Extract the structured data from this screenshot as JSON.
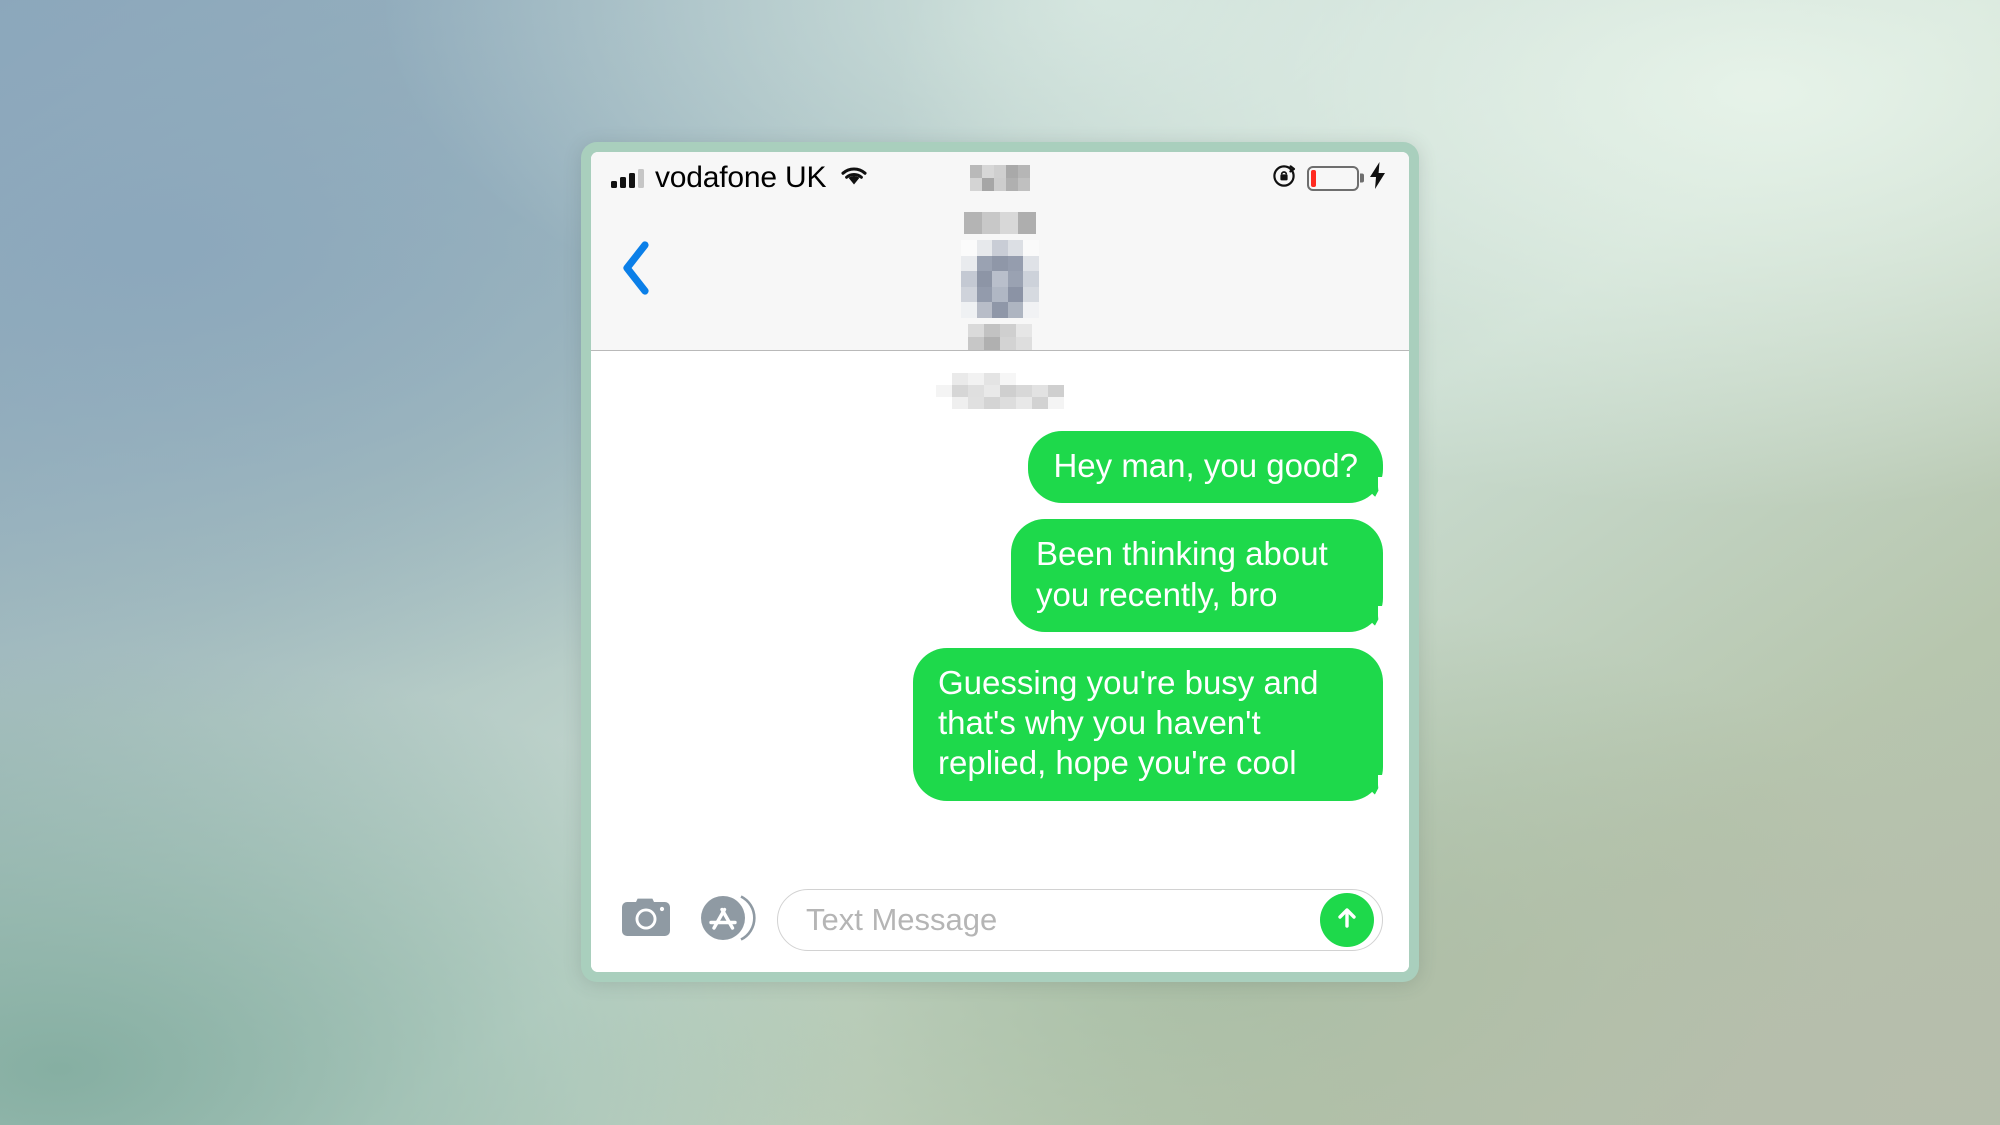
{
  "wallpaper": {
    "description": "blurred gradient backdrop",
    "colors": {
      "top_left": "#8ba7bc",
      "top_right": "#e2efe6",
      "bottom_left": "#8bafa3",
      "bottom_right": "#b5bea c"
    }
  },
  "phone": {
    "frame_color": "#a9cfbd"
  },
  "status_bar": {
    "carrier": "vodafone UK",
    "signal_bars_total": 4,
    "signal_bars_filled": 3,
    "wifi_icon": "wifi-icon",
    "rotation_lock_icon": "rotation-lock-icon",
    "battery_percent": 12,
    "battery_color": "#ff2a20",
    "charging": true,
    "charging_icon": "lightning-bolt-icon",
    "center_label_censored": true
  },
  "nav_bar": {
    "back_icon": "chevron-left-icon",
    "back_color": "#0b7fe8",
    "contact_name_censored": true,
    "avatar_censored": true
  },
  "conversation": {
    "timestamp_censored": true,
    "messages": [
      {
        "text": "Hey man, you good?",
        "direction": "outgoing",
        "tail": true
      },
      {
        "text": "Been thinking about you recently, bro",
        "direction": "outgoing",
        "tail": true
      },
      {
        "text": "Guessing you're busy and that's why you haven't replied, hope you're cool",
        "direction": "outgoing",
        "tail": true
      }
    ],
    "bubble_color": "#1ed94b",
    "bubble_text_color": "#ffffff"
  },
  "composer": {
    "camera_icon": "camera-icon",
    "app_store_icon": "app-store-icon",
    "placeholder": "Text Message",
    "send_icon": "arrow-up-icon",
    "send_button_color": "#1ed94b"
  }
}
